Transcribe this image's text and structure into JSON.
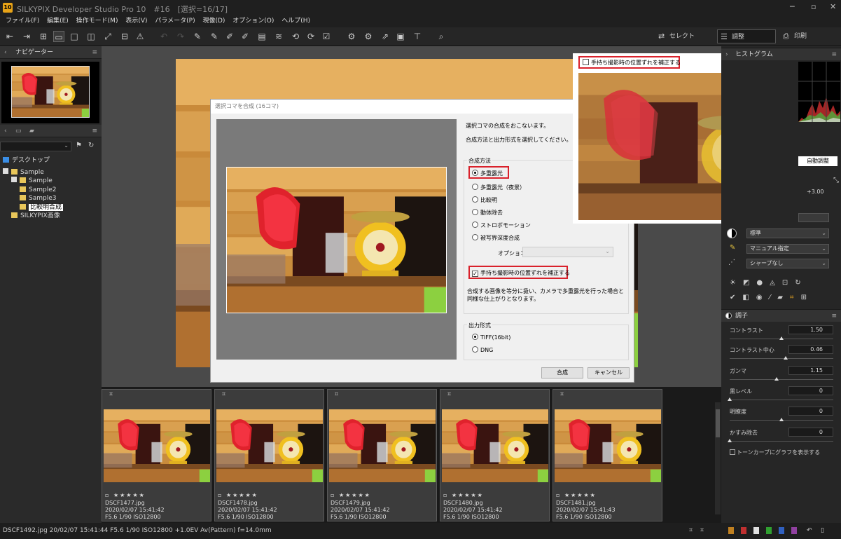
{
  "app": {
    "title": "SILKYPIX Developer Studio Pro 10　#16　[選択=16/17]"
  },
  "menu": [
    "ファイル(F)",
    "編集(E)",
    "操作モード(M)",
    "表示(V)",
    "パラメータ(P)",
    "現像(D)",
    "オプション(O)",
    "ヘルプ(H)"
  ],
  "toolbar": {
    "select_label": "セレクト",
    "adjust_label": "調整",
    "print_label": "印刷"
  },
  "left": {
    "navigator_title": "ナビゲーター",
    "tree": [
      {
        "label": "デスクトップ",
        "level": 0
      },
      {
        "label": "Sample",
        "level": 0
      },
      {
        "label": "Sample",
        "level": 1
      },
      {
        "label": "Sample2",
        "level": 1
      },
      {
        "label": "Sample3",
        "level": 1
      },
      {
        "label": "比較明合成",
        "level": 1
      },
      {
        "label": "SILKYPIX画像",
        "level": 1
      }
    ]
  },
  "dialog": {
    "title": "選択コマを合成 (16コマ)",
    "intro1": "選択コマの合成をおこないます。",
    "intro2": "合成方法と出力形式を選択してください。",
    "method_group": "合成方法",
    "methods": [
      "多重露光",
      "多重露光（夜景）",
      "比較明",
      "動体除去",
      "ストロボモーション",
      "被写界深度合成"
    ],
    "option_label": "オプション",
    "align_label": "手持ち撮影時の位置ずれを補正する",
    "description": "合成する画像を等分に扱い、カメラで多重露光を行った場合と同様な仕上がりとなります。",
    "output_group": "出力形式",
    "outputs": [
      "TIFF(16bit)",
      "DNG"
    ],
    "ok_label": "合成",
    "cancel_label": "キャンセル"
  },
  "popup": {
    "align_label": "手持ち撮影時の位置ずれを補正する"
  },
  "right": {
    "histogram_title": "ヒストグラム",
    "auto_adjust": "自動調整",
    "exposure_value": "+3.00",
    "dropdowns": [
      "標準",
      "マニュアル指定",
      "シャープなし"
    ],
    "tone_title": "調子",
    "sliders": [
      {
        "label": "コントラスト",
        "value": "1.50",
        "pos": 0.5
      },
      {
        "label": "コントラスト中心",
        "value": "0.46",
        "pos": 0.54
      },
      {
        "label": "ガンマ",
        "value": "1.15",
        "pos": 0.45
      },
      {
        "label": "黒レベル",
        "value": "0",
        "pos": 0.0
      },
      {
        "label": "明瞭度",
        "value": "0",
        "pos": 0.5
      },
      {
        "label": "かすみ除去",
        "value": "0",
        "pos": 0.0
      }
    ],
    "tonecurve_label": "トーンカーブにグラフを表示する"
  },
  "filmstrip": [
    {
      "name": "DSCF1477.jpg",
      "date": "2020/02/07 15:41:42",
      "exif": "F5.6 1/90 ISO12800"
    },
    {
      "name": "DSCF1478.jpg",
      "date": "2020/02/07 15:41:42",
      "exif": "F5.6 1/90 ISO12800"
    },
    {
      "name": "DSCF1479.jpg",
      "date": "2020/02/07 15:41:42",
      "exif": "F5.6 1/90 ISO12800"
    },
    {
      "name": "DSCF1480.jpg",
      "date": "2020/02/07 15:41:42",
      "exif": "F5.6 1/90 ISO12800"
    },
    {
      "name": "DSCF1481.jpg",
      "date": "2020/02/07 15:41:43",
      "exif": "F5.6 1/90 ISO12800"
    }
  ],
  "status": {
    "text": "DSCF1492.jpg 20/02/07 15:41:44 F5.6 1/90 ISO12800 +1.0EV Av(Pattern) f=14.0mm"
  }
}
